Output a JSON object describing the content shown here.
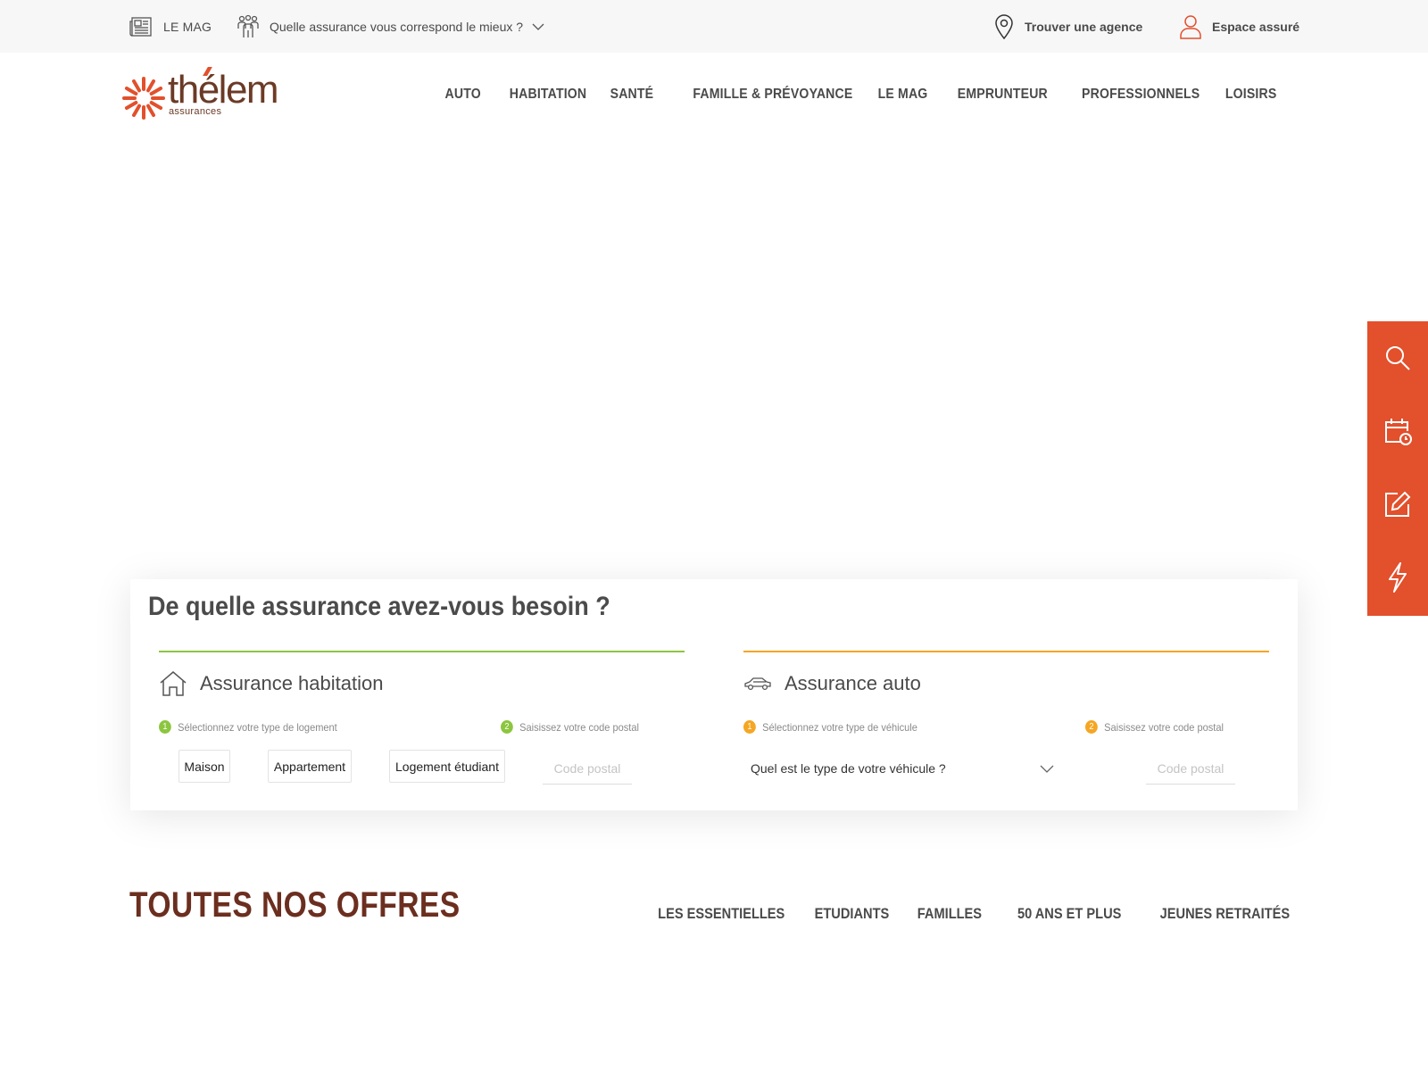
{
  "topbar": {
    "mag_label": "LE MAG",
    "quelle_label": "Quelle assurance vous correspond le mieux ?",
    "agence_label": "Trouver une agence",
    "espace_label": "Espace assuré"
  },
  "logo": {
    "word": "thélem",
    "sub": "assurances"
  },
  "nav": {
    "items": [
      "AUTO",
      "HABITATION",
      "SANTÉ",
      "FAMILLE & PRÉVOYANCE",
      "LE MAG",
      "EMPRUNTEUR",
      "PROFESSIONNELS",
      "LOISIRS"
    ]
  },
  "search": {
    "title": "De quelle assurance avez-vous besoin ?",
    "habitation": {
      "title": "Assurance habitation",
      "step1_num": "1",
      "step1": "Sélectionnez votre type de logement",
      "step2_num": "2",
      "step2": "Saisissez votre code postal",
      "options": [
        "Maison",
        "Appartement",
        "Logement étudiant"
      ],
      "cp_placeholder": "Code postal"
    },
    "auto": {
      "title": "Assurance auto",
      "step1_num": "1",
      "step1": "Sélectionnez votre type de véhicule",
      "step2_num": "2",
      "step2": "Saisissez votre code postal",
      "select_value": "Quel est le type de votre véhicule ?",
      "cp_placeholder": "Code postal"
    }
  },
  "offers": {
    "title": "TOUTES NOS OFFRES",
    "tabs": [
      "LES ESSENTIELLES",
      "ETUDIANTS",
      "FAMILLES",
      "50 ANS ET PLUS",
      "JEUNES RETRAITÉS"
    ]
  },
  "sidebar": {
    "icons": [
      "search-icon",
      "calendar-clock-icon",
      "edit-icon",
      "lightning-icon"
    ]
  },
  "colors": {
    "brand": "#e2502c",
    "brown": "#6b2e1f",
    "green": "#8cc63f",
    "orange": "#f5a623"
  }
}
